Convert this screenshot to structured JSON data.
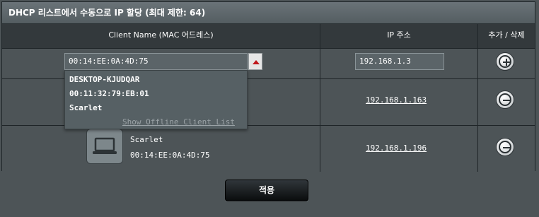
{
  "title": "DHCP 리스트에서 수동으로 IP 할당 (최대 제한: 64)",
  "columns": {
    "client": "Client Name (MAC 어드레스)",
    "ip": "IP 주소",
    "action": "추가 / 삭제"
  },
  "new_entry": {
    "mac_value": "00:14:EE:0A:4D:75",
    "ip_value": "192.168.1.3",
    "action_icon": "plus-circle-icon"
  },
  "dropdown": {
    "options": [
      "DESKTOP-KJUDQAR",
      "00:11:32:79:EB:01",
      "Scarlet"
    ],
    "offline_link": "Show Offline Client List"
  },
  "rows": [
    {
      "ip": "192.168.1.163",
      "action_icon": "minus-circle-icon"
    },
    {
      "name": "Scarlet",
      "mac": "00:14:EE:0A:4D:75",
      "ip": "192.168.1.196",
      "device_icon": "laptop-icon",
      "action_icon": "minus-circle-icon"
    }
  ],
  "apply_label": "적용",
  "colors": {
    "background": "#4d5457",
    "header": "#33393c",
    "dropdown_arrow": "#c0161b"
  }
}
